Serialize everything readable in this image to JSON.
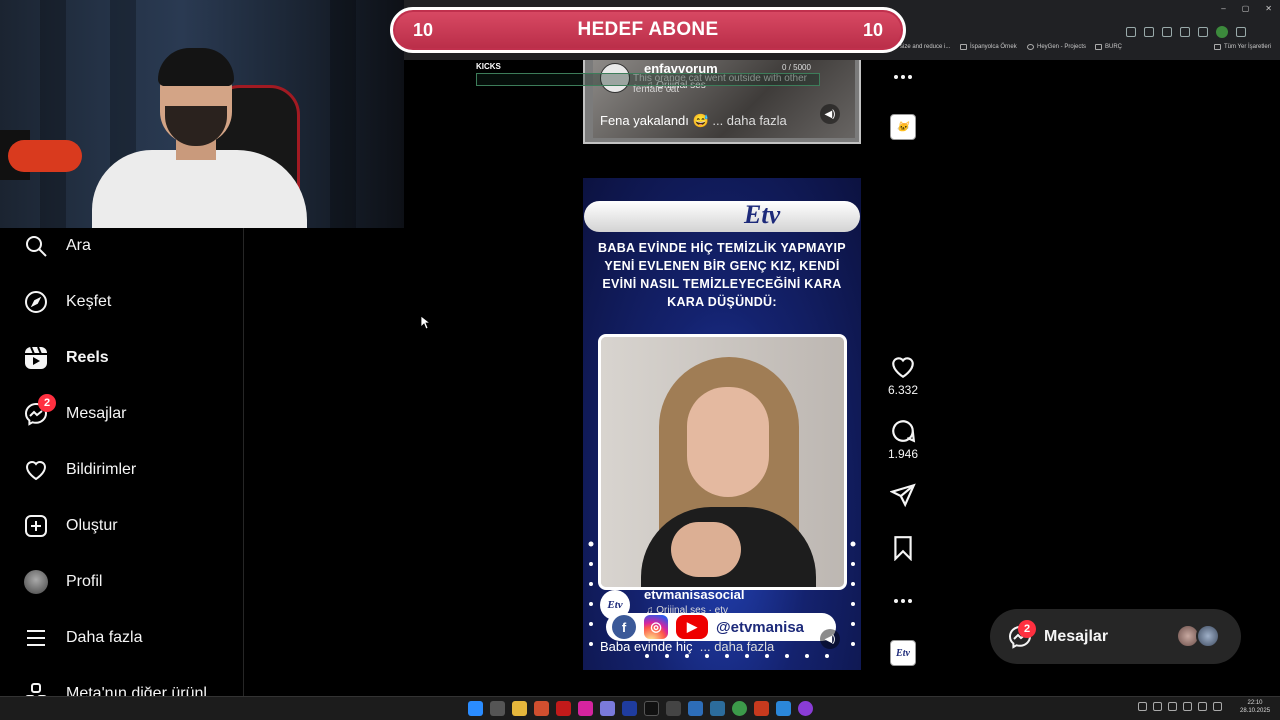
{
  "browser": {
    "bookmarks": [
      "size and reduce i...",
      "İspanyolca Örnek",
      "HeyGen - Projects",
      "BURÇ",
      "Tüm Yer İşaretleri"
    ],
    "window_controls": [
      "–",
      "▢",
      "✕"
    ]
  },
  "goal_banner": {
    "left_count": "10",
    "title": "HEDEF ABONE",
    "right_count": "10"
  },
  "kicks_overlay": {
    "label": "KICKS",
    "count": "0 / 5000"
  },
  "sidebar": {
    "items": [
      {
        "label": "Ara",
        "icon": "search-icon"
      },
      {
        "label": "Keşfet",
        "icon": "compass-icon"
      },
      {
        "label": "Reels",
        "icon": "reels-icon"
      },
      {
        "label": "Mesajlar",
        "icon": "messenger-icon",
        "badge": "2"
      },
      {
        "label": "Bildirimler",
        "icon": "heart-icon"
      },
      {
        "label": "Oluştur",
        "icon": "plus-square-icon"
      },
      {
        "label": "Profil",
        "icon": "avatar"
      },
      {
        "label": "Daha fazla",
        "icon": "hamburger-icon"
      },
      {
        "label": "Meta'nın diğer ürünl",
        "icon": "meta-icon"
      }
    ]
  },
  "reel_top": {
    "username": "enfavvorum",
    "audio": "Orijinal ses",
    "overlay_text": "This orange cat went outside with other female cat",
    "caption": "Fena yakalandı",
    "caption_emoji": "😅",
    "more": "... daha fazla"
  },
  "reel_main": {
    "channel_logo": "Etv",
    "headline": "BABA EVİNDE HİÇ TEMİZLİK YAPMAYIP YENİ EVLENEN BİR GENÇ KIZ, KENDİ EVİNİ NASIL TEMİZLEYECEĞİNİ KARA KARA DÜŞÜNDÜ:",
    "username": "etvmanisasocial",
    "audio": "Orijinal ses · etv",
    "social_handle": "@etvmanisa",
    "caption": "Baba evinde hiç",
    "more": "... daha fazla",
    "likes": "6.332",
    "comments": "1.946"
  },
  "messages_pill": {
    "label": "Mesajlar",
    "badge": "2"
  },
  "taskbar": {
    "time": "22:10",
    "date": "28.10.2025"
  },
  "colors": {
    "goal_pink": "#c0304d",
    "badge_red": "#ff3040",
    "etv_blue": "#1d2a7a"
  }
}
